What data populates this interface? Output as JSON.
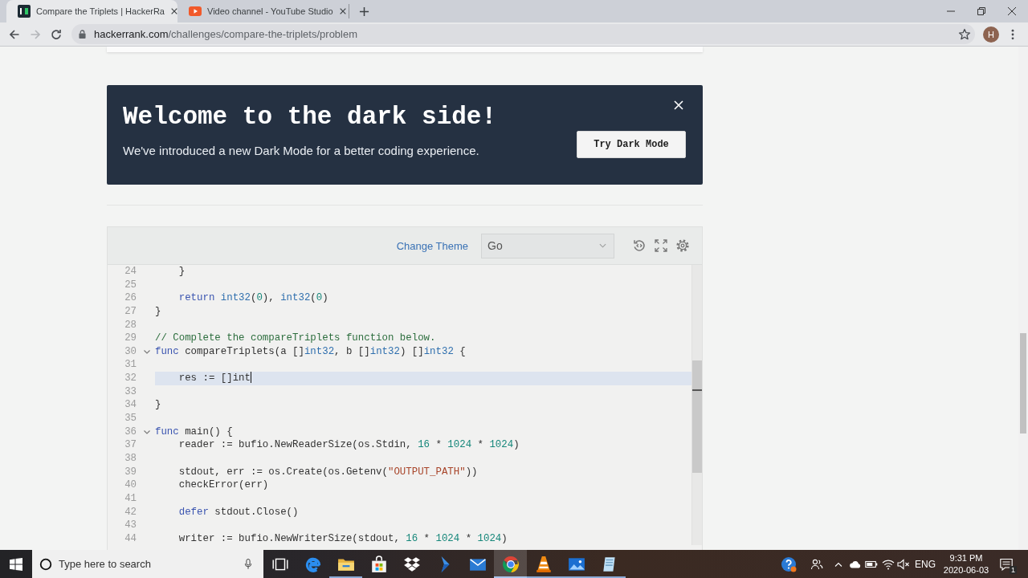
{
  "browser": {
    "tabs": [
      {
        "title": "Compare the Triplets | HackerRa",
        "kind": "square",
        "selected": true
      },
      {
        "title": "Video channel - YouTube Studio",
        "kind": "play",
        "selected": false
      }
    ],
    "nav": [
      {
        "kind": "back",
        "disabled": false
      },
      {
        "kind": "forward",
        "disabled": true
      },
      {
        "kind": "reload",
        "disabled": false
      }
    ],
    "url": {
      "host": "hackerrank.com",
      "path": "/challenges/compare-the-triplets/problem"
    },
    "profile_initial": "H"
  },
  "banner": {
    "title": "Welcome to the dark side!",
    "text": "We've introduced a new Dark Mode for a better coding experience.",
    "button": "Try Dark Mode"
  },
  "editor": {
    "theme_link": "Change Theme",
    "language": "Go",
    "lines": [
      {
        "number": "24",
        "fold": false,
        "selected": false,
        "indent": true,
        "tokens": [
          {
            "kind": "plain",
            "text": "}"
          }
        ]
      },
      {
        "number": "25",
        "fold": false,
        "selected": false
      },
      {
        "number": "26",
        "fold": false,
        "selected": false,
        "indent": true,
        "tokens": [
          {
            "kind": "keyword",
            "text": "return"
          },
          {
            "kind": "type",
            "text": " int32"
          },
          {
            "kind": "plain",
            "text": "("
          },
          {
            "kind": "number",
            "text": "0"
          },
          {
            "kind": "plain",
            "text": "), "
          },
          {
            "kind": "type",
            "text": "int32"
          },
          {
            "kind": "plain",
            "text": "("
          },
          {
            "kind": "number",
            "text": "0"
          },
          {
            "kind": "plain",
            "text": ")"
          }
        ]
      },
      {
        "number": "27",
        "fold": false,
        "selected": false,
        "indent": false,
        "tokens": [
          {
            "kind": "plain",
            "text": "}"
          }
        ]
      },
      {
        "number": "28",
        "fold": false,
        "selected": false
      },
      {
        "number": "29",
        "fold": false,
        "selected": false,
        "indent": false,
        "tokens": [
          {
            "kind": "comment",
            "text": "// Complete the compareTriplets function below."
          }
        ]
      },
      {
        "number": "30",
        "fold": true,
        "selected": false,
        "indent": false,
        "tokens": [
          {
            "kind": "keyword",
            "text": "func"
          },
          {
            "kind": "plain",
            "text": " compareTriplets(a []"
          },
          {
            "kind": "type",
            "text": "int32"
          },
          {
            "kind": "plain",
            "text": ", b []"
          },
          {
            "kind": "type",
            "text": "int32"
          },
          {
            "kind": "plain",
            "text": ") []"
          },
          {
            "kind": "type",
            "text": "int32"
          },
          {
            "kind": "plain",
            "text": " {"
          }
        ]
      },
      {
        "number": "31",
        "fold": false,
        "selected": false
      },
      {
        "number": "32",
        "fold": false,
        "selected": true,
        "indent": true,
        "tokens": [
          {
            "kind": "plain",
            "text": "res := []int"
          }
        ]
      },
      {
        "number": "33",
        "fold": false,
        "selected": false
      },
      {
        "number": "34",
        "fold": false,
        "selected": false,
        "indent": false,
        "tokens": [
          {
            "kind": "plain",
            "text": "}"
          }
        ]
      },
      {
        "number": "35",
        "fold": false,
        "selected": false
      },
      {
        "number": "36",
        "fold": true,
        "selected": false,
        "indent": false,
        "tokens": [
          {
            "kind": "keyword",
            "text": "func"
          },
          {
            "kind": "plain",
            "text": " main() {"
          }
        ]
      },
      {
        "number": "37",
        "fold": false,
        "selected": false,
        "indent": true,
        "tokens": [
          {
            "kind": "plain",
            "text": "reader := bufio.NewReaderSize(os.Stdin, "
          },
          {
            "kind": "number",
            "text": "16"
          },
          {
            "kind": "plain",
            "text": " * "
          },
          {
            "kind": "number",
            "text": "1024"
          },
          {
            "kind": "plain",
            "text": " * "
          },
          {
            "kind": "number",
            "text": "1024"
          },
          {
            "kind": "plain",
            "text": ")"
          }
        ]
      },
      {
        "number": "38",
        "fold": false,
        "selected": false
      },
      {
        "number": "39",
        "fold": false,
        "selected": false,
        "indent": true,
        "tokens": [
          {
            "kind": "plain",
            "text": "stdout, err := os.Create(os.Getenv("
          },
          {
            "kind": "string",
            "text": "\"OUTPUT_PATH\""
          },
          {
            "kind": "plain",
            "text": "))"
          }
        ]
      },
      {
        "number": "40",
        "fold": false,
        "selected": false,
        "indent": true,
        "tokens": [
          {
            "kind": "plain",
            "text": "checkError(err)"
          }
        ]
      },
      {
        "number": "41",
        "fold": false,
        "selected": false
      },
      {
        "number": "42",
        "fold": false,
        "selected": false,
        "indent": true,
        "tokens": [
          {
            "kind": "keyword",
            "text": "defer"
          },
          {
            "kind": "plain",
            "text": " stdout.Close()"
          }
        ]
      },
      {
        "number": "43",
        "fold": false,
        "selected": false
      },
      {
        "number": "44",
        "fold": false,
        "selected": false,
        "indent": true,
        "tokens": [
          {
            "kind": "plain",
            "text": "writer := bufio.NewWriterSize(stdout, "
          },
          {
            "kind": "number",
            "text": "16"
          },
          {
            "kind": "plain",
            "text": " * "
          },
          {
            "kind": "number",
            "text": "1024"
          },
          {
            "kind": "plain",
            "text": " * "
          },
          {
            "kind": "number",
            "text": "1024"
          },
          {
            "kind": "plain",
            "text": ")"
          }
        ]
      }
    ]
  },
  "taskbar": {
    "search_placeholder": "Type here to search",
    "apps": [
      {
        "kind": "taskview",
        "open": false,
        "selected": false
      },
      {
        "kind": "edge",
        "open": false,
        "selected": false
      },
      {
        "kind": "folder",
        "open": true,
        "selected": false
      },
      {
        "kind": "store",
        "open": false,
        "selected": false
      },
      {
        "kind": "dropbox",
        "open": false,
        "selected": false
      },
      {
        "kind": "bolt",
        "open": false,
        "selected": false
      },
      {
        "kind": "mail",
        "open": false,
        "selected": false
      },
      {
        "kind": "chrome",
        "open": true,
        "selected": true
      },
      {
        "kind": "cone",
        "open": true,
        "selected": false
      },
      {
        "kind": "photos",
        "open": true,
        "selected": false
      },
      {
        "kind": "notepad",
        "open": true,
        "selected": false
      }
    ],
    "language": "ENG",
    "time": "9:31 PM",
    "date": "2020-06-03",
    "notifications": "1"
  }
}
